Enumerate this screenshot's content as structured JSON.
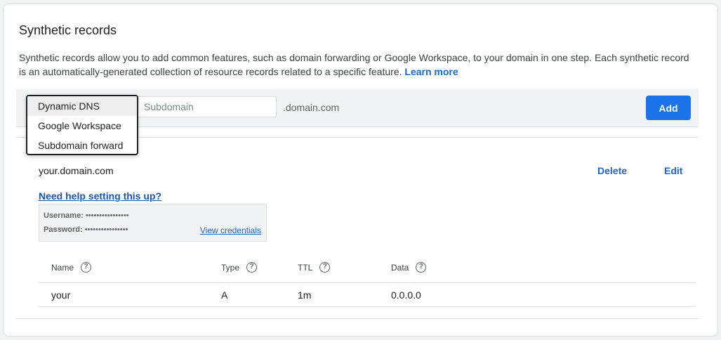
{
  "section": {
    "title": "Synthetic records",
    "description": "Synthetic records allow you to add common features, such as domain forwarding or Google Workspace, to your domain in one step. Each synthetic record is an automatically-generated collection of resource records related to a specific feature.",
    "learn_more": "Learn more"
  },
  "form": {
    "type_options": [
      "Dynamic DNS",
      "Google Workspace",
      "Subdomain forward"
    ],
    "selected_option": "Dynamic DNS",
    "subdomain_placeholder": "Subdomain",
    "domain_suffix": ".domain.com",
    "add_label": "Add"
  },
  "record": {
    "domain": "your.domain.com",
    "delete_label": "Delete",
    "edit_label": "Edit",
    "help_link": "Need help setting this up?",
    "credentials": {
      "username_label": "Username:",
      "username_value": "••••••••••••••••",
      "password_label": "Password:",
      "password_value": "••••••••••••••••",
      "view_label": "View credentials"
    },
    "table": {
      "columns": [
        "Name",
        "Type",
        "TTL",
        "Data"
      ],
      "help_glyph": "?",
      "rows": [
        [
          "your",
          "A",
          "1m",
          "0.0.0.0"
        ]
      ]
    }
  },
  "colors": {
    "accent": "#1a73e8",
    "link": "#1967d2"
  }
}
